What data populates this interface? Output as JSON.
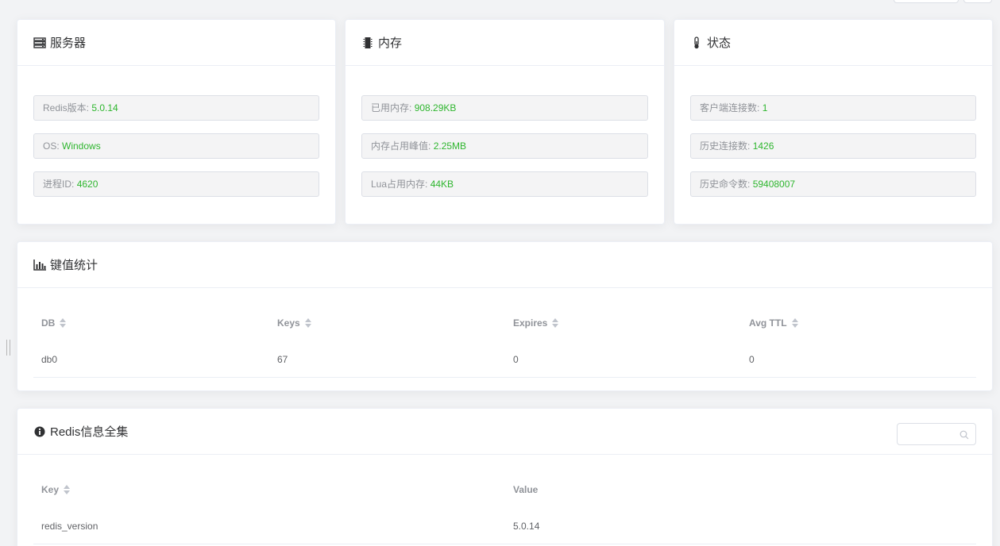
{
  "server": {
    "title": "服务器",
    "items": [
      {
        "label": "Redis版本:",
        "value": "5.0.14"
      },
      {
        "label": "OS:",
        "value": "Windows"
      },
      {
        "label": "进程ID:",
        "value": "4620"
      }
    ]
  },
  "memory": {
    "title": "内存",
    "items": [
      {
        "label": "已用内存:",
        "value": "908.29KB"
      },
      {
        "label": "内存占用峰值:",
        "value": "2.25MB"
      },
      {
        "label": "Lua占用内存:",
        "value": "44KB"
      }
    ]
  },
  "status": {
    "title": "状态",
    "items": [
      {
        "label": "客户端连接数:",
        "value": "1"
      },
      {
        "label": "历史连接数:",
        "value": "1426"
      },
      {
        "label": "历史命令数:",
        "value": "59408007"
      }
    ]
  },
  "keystats": {
    "title": "键值统计",
    "columns": [
      "DB",
      "Keys",
      "Expires",
      "Avg TTL"
    ],
    "rows": [
      [
        "db0",
        "67",
        "0",
        "0"
      ]
    ]
  },
  "info": {
    "title": "Redis信息全集",
    "search_placeholder": "",
    "columns": [
      "Key",
      "Value"
    ],
    "rows": [
      [
        "redis_version",
        "5.0.14"
      ]
    ]
  },
  "colors": {
    "value_green": "#2fb62f",
    "page_bg": "#f2f3f5"
  }
}
